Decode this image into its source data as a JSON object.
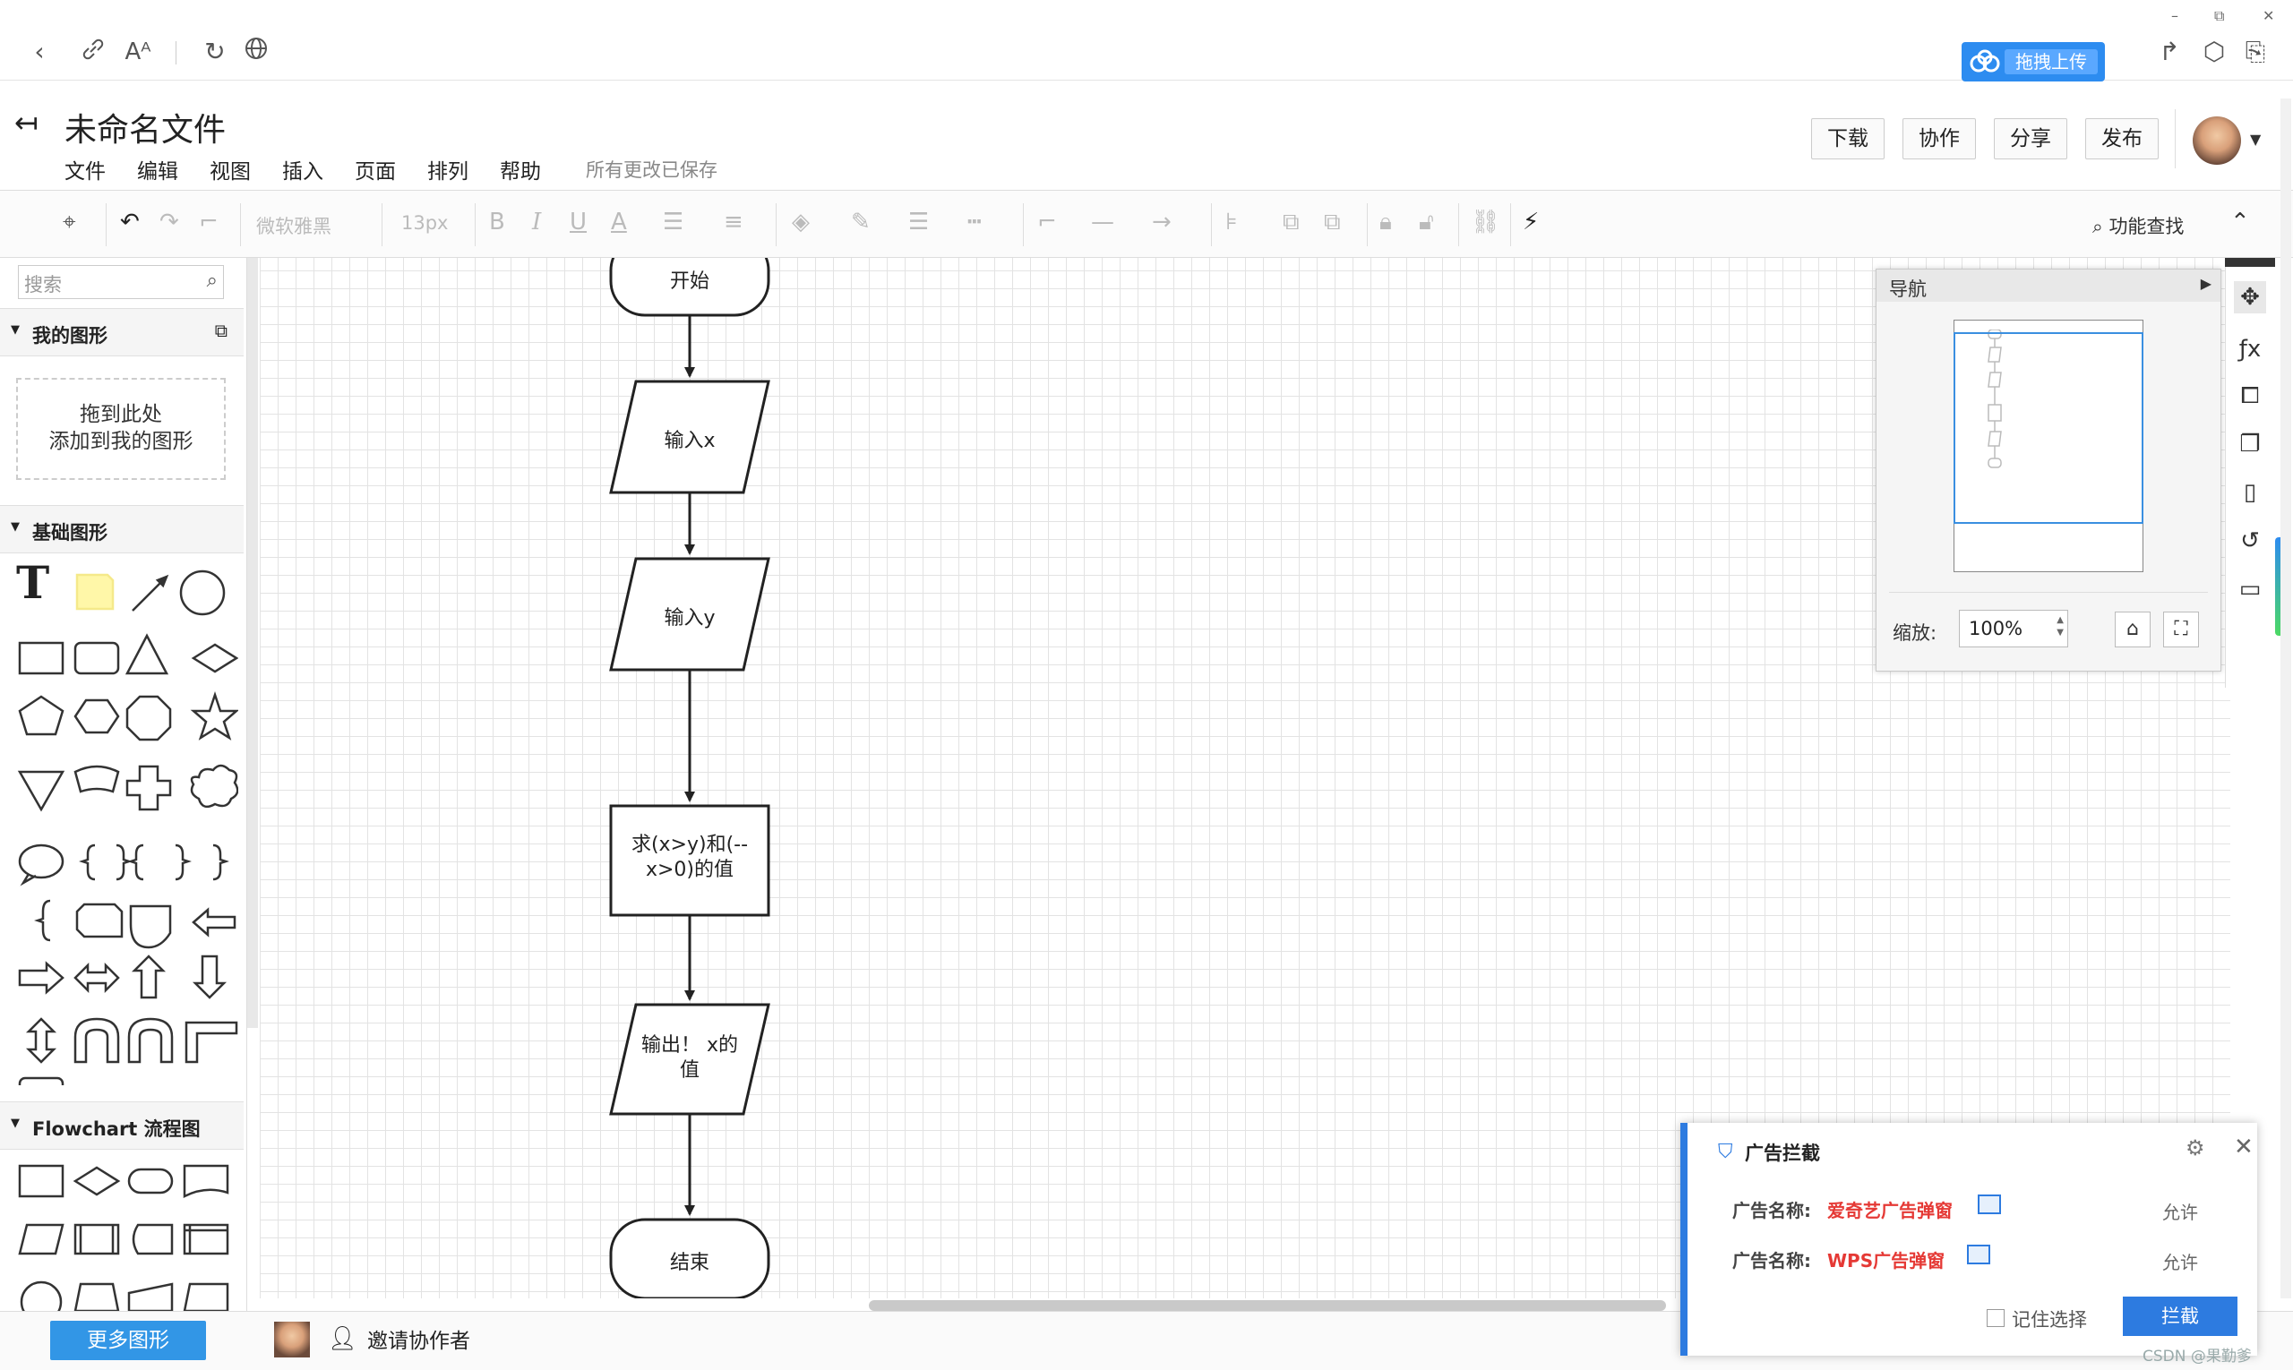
{
  "browser": {
    "upload_label": "拖拽上传",
    "window_minimize": "–",
    "window_restore": "⧉",
    "window_close": "✕"
  },
  "header": {
    "doc_title": "未命名文件",
    "menu": [
      "文件",
      "编辑",
      "视图",
      "插入",
      "页面",
      "排列",
      "帮助"
    ],
    "save_status": "所有更改已保存",
    "buttons": {
      "download": "下载",
      "collab": "协作",
      "share": "分享",
      "publish": "发布"
    }
  },
  "toolbar": {
    "font_family": "微软雅黑",
    "font_size": "13px",
    "bold": "B",
    "italic": "I",
    "underline": "U",
    "font_color": "A",
    "feature_search": "功能查找"
  },
  "left_panel": {
    "search_placeholder": "搜索",
    "sections": {
      "my_shapes": "我的图形",
      "basic_shapes": "基础图形",
      "flowchart": "Flowchart 流程图"
    },
    "dropzone_line1": "拖到此处",
    "dropzone_line2": "添加到我的图形",
    "more_shapes": "更多图形"
  },
  "flowchart": {
    "nodes": {
      "start": "开始",
      "input_x": "输入x",
      "input_y": "输入y",
      "compute_1": "求(x>y)和(--",
      "compute_2": "x>0)的值",
      "output_1": "输出！ x的",
      "output_2": "值",
      "end": "结束"
    }
  },
  "navigator": {
    "title": "导航",
    "zoom_label": "缩放:",
    "zoom_value": "100%"
  },
  "bottom": {
    "invite": "邀请协作者"
  },
  "ad_dialog": {
    "title": "广告拦截",
    "rows": [
      {
        "label": "广告名称:",
        "name": "爱奇艺广告弹窗",
        "action": "允许"
      },
      {
        "label": "广告名称:",
        "name": "WPS广告弹窗",
        "action": "允许"
      }
    ],
    "remember": "记住选择",
    "block": "拦截"
  },
  "watermark": "CSDN @果勤爹",
  "colors": {
    "accent": "#2d8cf0",
    "canvas_grid": "#e3e3e3",
    "ad_name": "#e53935"
  }
}
